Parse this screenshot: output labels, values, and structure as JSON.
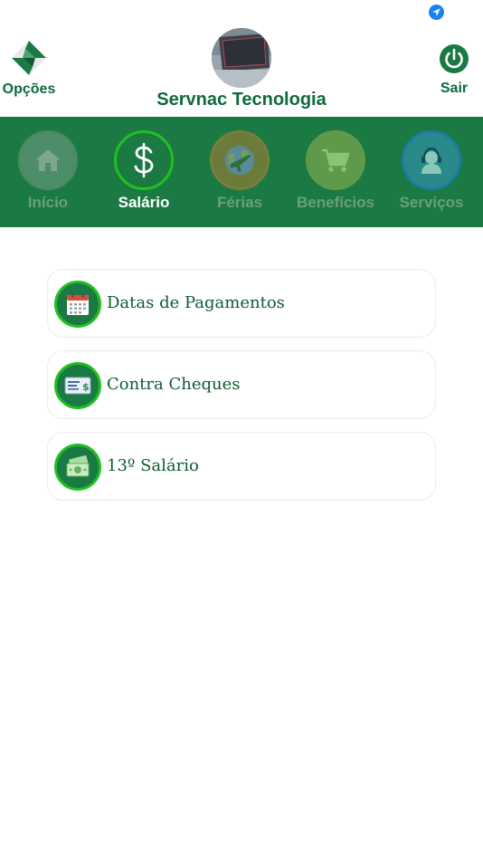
{
  "header": {
    "left_button_label": "Opções",
    "company_name": "Servnac Tecnologia",
    "right_button_label": "Sair"
  },
  "nav": {
    "items": [
      {
        "label": "Início",
        "icon": "home-icon",
        "active": false
      },
      {
        "label": "Salário",
        "icon": "dollar-icon",
        "active": true
      },
      {
        "label": "Férias",
        "icon": "globe-plane-icon",
        "active": false
      },
      {
        "label": "Benefícios",
        "icon": "cart-icon",
        "active": false
      },
      {
        "label": "Serviços",
        "icon": "support-agent-icon",
        "active": false
      }
    ]
  },
  "menu": {
    "items": [
      {
        "label": "Datas de Pagamentos",
        "icon": "calendar-icon"
      },
      {
        "label": "Contra Cheques",
        "icon": "check-icon"
      },
      {
        "label": "13º Salário",
        "icon": "money-icon"
      }
    ]
  },
  "colors": {
    "brand_green": "#1b7a44",
    "dark_green_text": "#0f6a3c",
    "active_ring": "#20c020",
    "inactive_label": "#6a9e7f"
  }
}
